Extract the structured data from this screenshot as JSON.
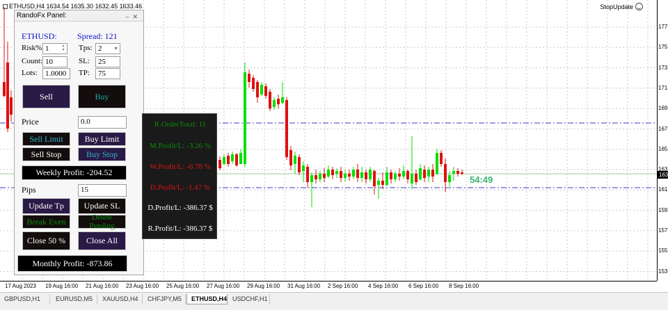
{
  "chart": {
    "symbol_header": "ETHUSD,H4  1634.54 1635.30 1632.45 1633.46",
    "stop_update": "StopUpdate",
    "countdown": "54:49",
    "current_price_label": "163",
    "price_ticks": [
      "177",
      "175",
      "173",
      "171",
      "169",
      "167",
      "165",
      "163",
      "161",
      "159",
      "157",
      "155",
      "153"
    ],
    "time_ticks": [
      "17 Aug 2023",
      "19 Aug 16:00",
      "21 Aug 16:00",
      "23 Aug 16:00",
      "25 Aug 16:00",
      "27 Aug 16:00",
      "29 Aug 16:00",
      "31 Aug 16:00",
      "2 Sep 16:00",
      "4 Sep 16:00",
      "6 Sep 16:00",
      "8 Sep 16:00"
    ],
    "colors": {
      "bull": "#00e000",
      "bear": "#e01010",
      "level_line": "#3838c8",
      "grid": "#c8c8c8"
    }
  },
  "tabs": [
    {
      "label": "GBPUSD,H1",
      "active": false
    },
    {
      "label": "EURUSD,M5",
      "active": false
    },
    {
      "label": "XAUUSD,H4",
      "active": false
    },
    {
      "label": "CHFJPY,M5",
      "active": false
    },
    {
      "label": "ETHUSD,H4",
      "active": true
    },
    {
      "label": "USDCHF,H1",
      "active": false
    }
  ],
  "panel": {
    "title": "RandoFx Panel:",
    "symbol": "ETHUSD:",
    "spread": "Spread: 121",
    "risk_label": "Risk%",
    "risk_value": "1",
    "tps_label": "Tps:",
    "tps_value": "2",
    "count_label": "Count:",
    "count_value": "10",
    "sl_label": "SL:",
    "sl_value": "25",
    "lots_label": "Lots:",
    "lots_value": "1.0000",
    "tp_label": "TP:",
    "tp_value": "75",
    "sell": "Sell",
    "buy": "Buy",
    "price_label": "Price",
    "price_value": "0.0",
    "sell_limit": "Sell Limit",
    "buy_limit": "Buy Limit",
    "sell_stop": "Sell Stop",
    "buy_stop": "Buy Stop",
    "weekly_profit": "Weekly Profit: -204.52",
    "pips_label": "Pips",
    "pips_value": "15",
    "update_tp": "Update Tp",
    "update_sl": "Update SL",
    "break_even": "Break Even",
    "delete_pending": "Delete Pending",
    "close_50": "Close 50 %",
    "close_all": "Close All",
    "monthly_profit": "Monthly Profit: -873.86"
  },
  "stats": {
    "order_total": "R.OrderTotal: 11",
    "m_profit": "M.Profit/L: -3.26 %",
    "w_profit": "W.Profit/L: -0.78 %",
    "d_profit": "D.Profit/L: -1.47 %",
    "d_profit_usd": "D.Profit/L: -386.37 $",
    "r_profit_usd": "R.Profit/L: -386.37 $"
  }
}
